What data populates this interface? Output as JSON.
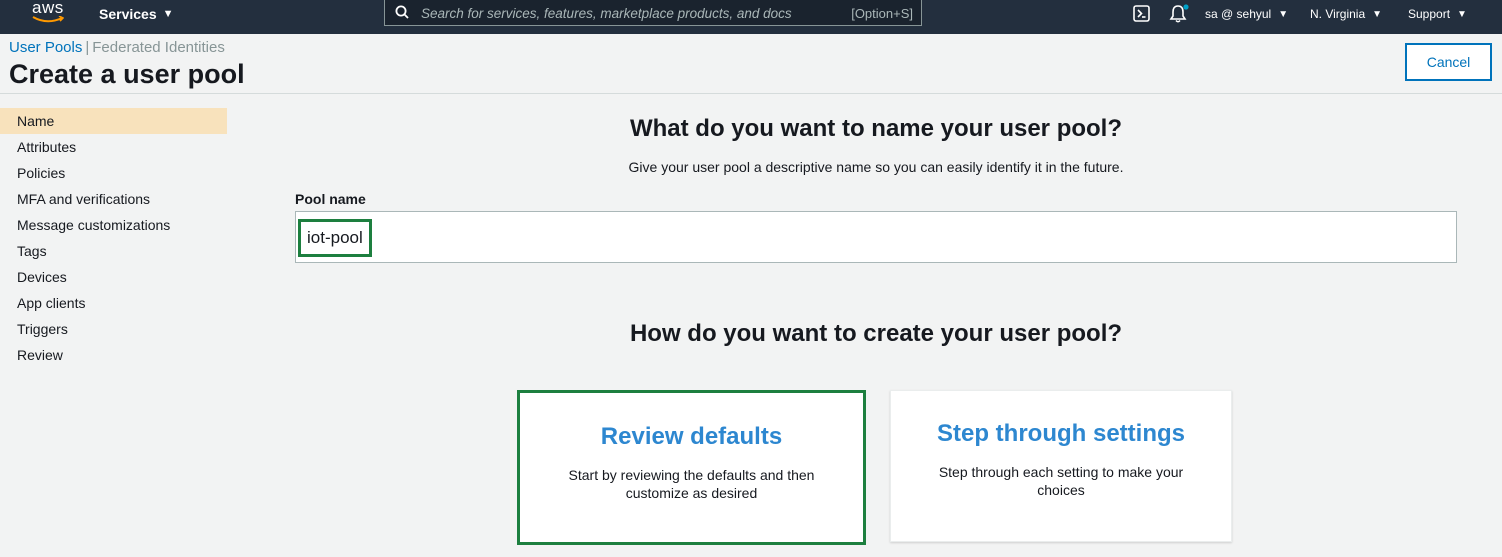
{
  "topnav": {
    "logo_text": "aws",
    "services_label": "Services",
    "search_placeholder": "Search for services, features, marketplace products, and docs",
    "search_shortcut": "[Option+S]",
    "account_label": "sa @ sehyul",
    "region_label": "N. Virginia",
    "support_label": "Support",
    "icons": [
      "cloudshell-icon",
      "bell-icon"
    ],
    "notification_dot_color": "#00a1c9"
  },
  "breadcrumb": {
    "active": "User Pools",
    "separator": "|",
    "other": "Federated Identities"
  },
  "page_title": "Create a user pool",
  "cancel_label": "Cancel",
  "sidenav": {
    "items": [
      {
        "label": "Name",
        "active": true
      },
      {
        "label": "Attributes"
      },
      {
        "label": "Policies"
      },
      {
        "label": "MFA and verifications"
      },
      {
        "label": "Message customizations"
      },
      {
        "label": "Tags"
      },
      {
        "label": "Devices"
      },
      {
        "label": "App clients"
      },
      {
        "label": "Triggers"
      },
      {
        "label": "Review"
      }
    ]
  },
  "main": {
    "name_heading": "What do you want to name your user pool?",
    "name_sub": "Give your user pool a descriptive name so you can easily identify it in the future.",
    "pool_name_label": "Pool name",
    "pool_name_value": "iot-pool",
    "create_heading": "How do you want to create your user pool?",
    "options": [
      {
        "title": "Review defaults",
        "desc": "Start by reviewing the defaults and then customize as desired"
      },
      {
        "title": "Step through settings",
        "desc": "Step through each setting to make your choices"
      }
    ]
  },
  "colors": {
    "nav_bg": "#232f3e",
    "link_blue": "#0073bb",
    "card_title_blue": "#2d87d0",
    "highlight_green": "#1d7f3f",
    "active_nav_bg": "#f8e2bc"
  }
}
